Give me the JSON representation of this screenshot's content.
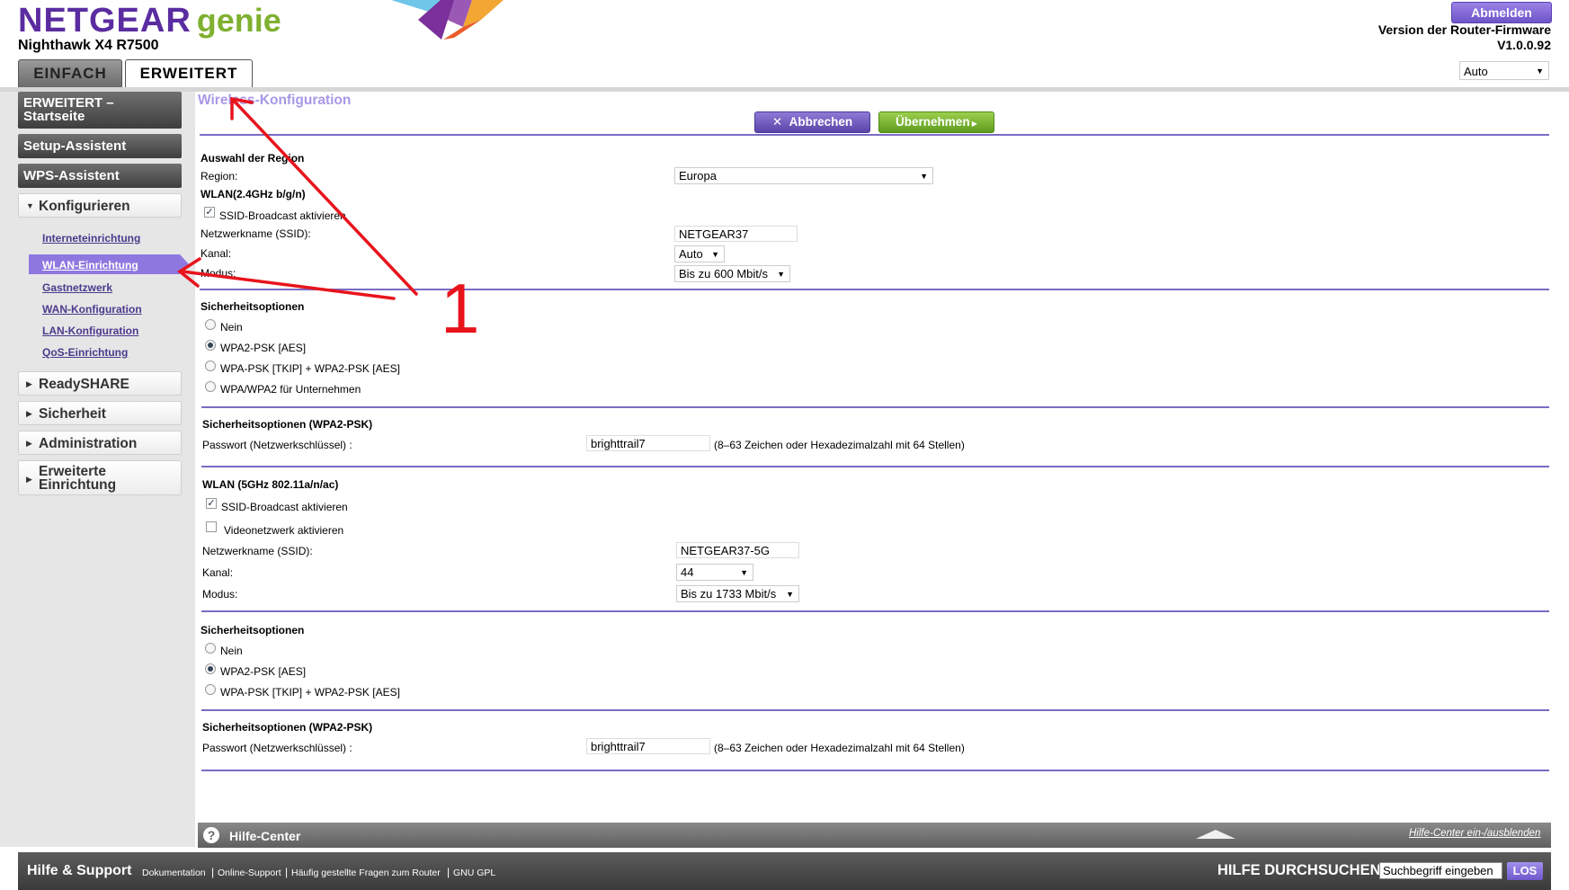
{
  "header": {
    "logo_brand": "NETGEAR",
    "logo_product": "genie",
    "model": "Nighthawk X4 R7500",
    "logout_label": "Abmelden",
    "firmware_label": "Version der Router-Firmware",
    "firmware_version": "V1.0.0.92",
    "language_value": "Auto",
    "tab_basic": "EINFACH",
    "tab_advanced": "ERWEITERT"
  },
  "sidebar": {
    "home": [
      "ERWEITERT –",
      "Startseite"
    ],
    "setup_wizard": "Setup-Assistent",
    "wps_wizard": "WPS-Assistent",
    "configure": "Konfigurieren",
    "sub_items": [
      "Interneteinrichtung",
      "WLAN-Einrichtung",
      "Gastnetzwerk",
      "WAN-Konfiguration",
      "LAN-Konfiguration",
      "QoS-Einrichtung"
    ],
    "readyshare": "ReadySHARE",
    "security": "Sicherheit",
    "administration": "Administration",
    "advanced_setup": [
      "Erweiterte",
      "Einrichtung"
    ]
  },
  "page": {
    "title": "Wireless-Konfiguration",
    "cancel_label": "Abbrechen",
    "apply_label": "Übernehmen"
  },
  "region": {
    "heading": "Auswahl der Region",
    "label": "Region:",
    "value": "Europa"
  },
  "wlan24": {
    "heading": "WLAN(2.4GHz b/g/n)",
    "ssid_broadcast_label": "SSID-Broadcast aktivieren",
    "ssid_label": "Netzwerkname (SSID):",
    "ssid_value": "NETGEAR37",
    "channel_label": "Kanal:",
    "channel_value": "Auto",
    "mode_label": "Modus:",
    "mode_value": "Bis zu 600 Mbit/s"
  },
  "security24": {
    "heading": "Sicherheitsoptionen",
    "options": [
      "Nein",
      "WPA2-PSK [AES]",
      "WPA-PSK [TKIP] + WPA2-PSK [AES]",
      "WPA/WPA2 für Unternehmen"
    ],
    "psk_heading": "Sicherheitsoptionen (WPA2-PSK)",
    "password_label": "Passwort (Netzwerkschlüssel) :",
    "password_value": "brighttrail7",
    "password_hint": "(8–63 Zeichen oder Hexadezimalzahl mit 64 Stellen)"
  },
  "wlan5": {
    "heading": "WLAN (5GHz 802.11a/n/ac)",
    "ssid_broadcast_label": "SSID-Broadcast aktivieren",
    "video_label": "Videonetzwerk aktivieren",
    "ssid_label": "Netzwerkname (SSID):",
    "ssid_value": "NETGEAR37-5G",
    "channel_label": "Kanal:",
    "channel_value": "44",
    "mode_label": "Modus:",
    "mode_value": "Bis zu 1733 Mbit/s"
  },
  "security5": {
    "heading": "Sicherheitsoptionen",
    "options": [
      "Nein",
      "WPA2-PSK [AES]",
      "WPA-PSK [TKIP] + WPA2-PSK [AES]"
    ],
    "psk_heading": "Sicherheitsoptionen (WPA2-PSK)",
    "password_label": "Passwort (Netzwerkschlüssel) :",
    "password_value": "brighttrail7",
    "password_hint": "(8–63 Zeichen oder Hexadezimalzahl mit 64 Stellen)"
  },
  "help": {
    "title": "Hilfe-Center",
    "toggle": "Hilfe-Center ein-/ausblenden"
  },
  "footer": {
    "title": "Hilfe & Support",
    "links": [
      "Dokumentation",
      "Online-Support",
      "Häufig gestellte Fragen zum Router",
      "GNU GPL"
    ],
    "search_label": "HILFE DURCHSUCHEN",
    "search_placeholder": "Suchbegriff eingeben",
    "search_button": "LOS"
  },
  "annotation": {
    "number": "1",
    "color": "#e8141c"
  },
  "colors": {
    "brand_purple": "#5a2ca0",
    "genie_green": "#7fb030",
    "accent_lavender": "#8e78e0",
    "divider": "#7a6cc4"
  }
}
